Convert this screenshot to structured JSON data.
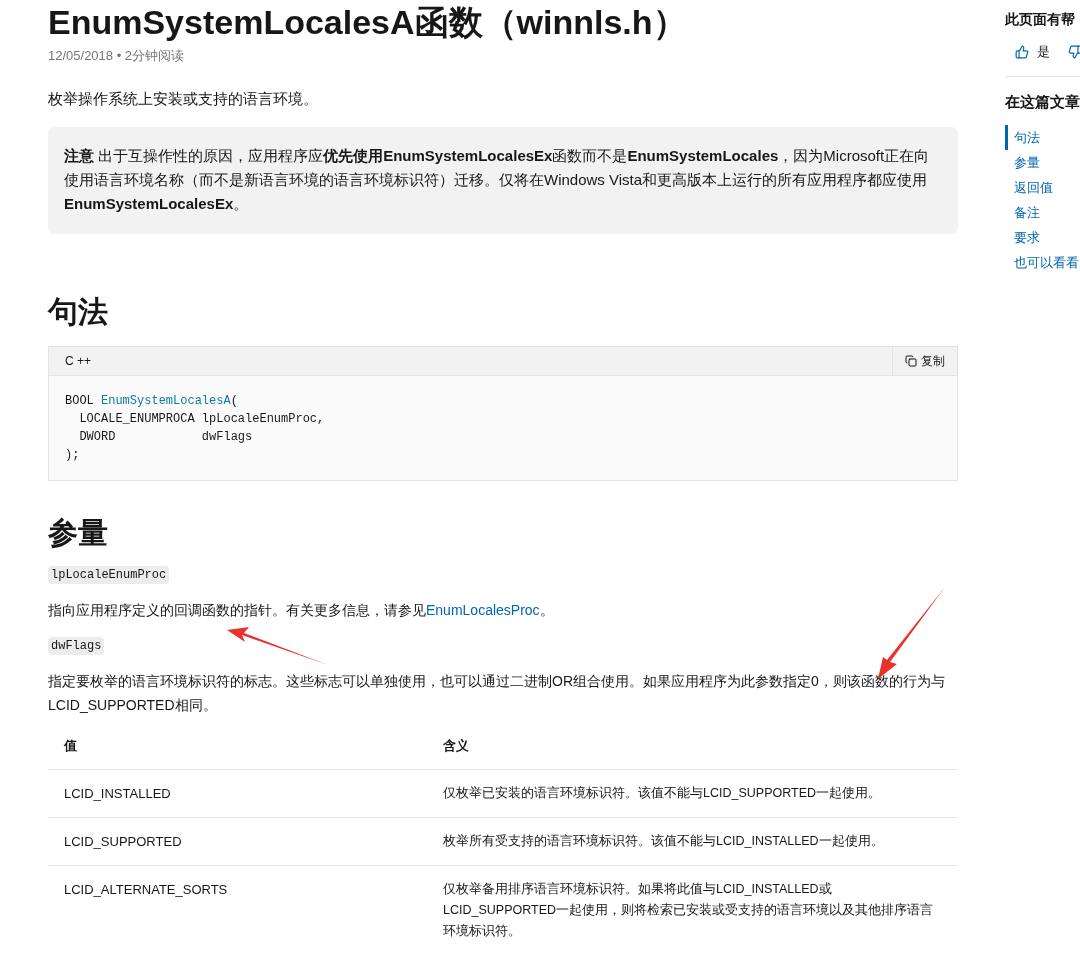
{
  "article": {
    "title": "EnumSystemLocalesA函数（winnls.h）",
    "meta": "12/05/2018 • 2分钟阅读",
    "summary": "枚举操作系统上安装或支持的语言环境。",
    "note": "**注意** 出于互操作性的原因，应用程序应**优先使用EnumSystemLocalesEx**函数而不是**EnumSystemLocales**，因为Microsoft正在向使用语言环境名称（而不是新语言环境的语言环境标识符）迁移。仅将在Windows Vista和更高版本上运行的所有应用程序都应使用**EnumSystemLocalesEx**。",
    "syntax_heading": "句法",
    "code": {
      "language": "C ++",
      "copy_label": "复制",
      "lines": [
        [
          {
            "kind": "plain",
            "text": "BOOL "
          },
          {
            "kind": "name",
            "text": "EnumSystemLocalesA"
          },
          {
            "kind": "plain",
            "text": "("
          }
        ],
        [
          {
            "kind": "plain",
            "text": "  LOCALE_ENUMPROCA lpLocaleEnumProc,"
          }
        ],
        [
          {
            "kind": "plain",
            "text": "  DWORD            dwFlags"
          }
        ],
        [
          {
            "kind": "plain",
            "text": ");"
          }
        ]
      ]
    },
    "params_heading": "参量",
    "params": [
      {
        "name": "lpLocaleEnumProc",
        "text_before": "指向应用程序定义的回调函数的指针。有关更多信息，请参见",
        "link": "EnumLocalesProc",
        "text_after": "。"
      },
      {
        "name": "dwFlags",
        "text_before": "指定要枚举的语言环境标识符的标志。这些标志可以单独使用，也可以通过二进制OR组合使用。如果应用程序为此参数指定0，则该函数的行为与LCID_SUPPORTED相同。"
      }
    ],
    "table": {
      "columns": [
        "值",
        "含义"
      ],
      "rows": [
        [
          "LCID_INSTALLED",
          "仅枚举已安装的语言环境标识符。该值不能与LCID_SUPPORTED一起使用。"
        ],
        [
          "LCID_SUPPORTED",
          "枚举所有受支持的语言环境标识符。该值不能与LCID_INSTALLED一起使用。"
        ],
        [
          "LCID_ALTERNATE_SORTS",
          "仅枚举备用排序语言环境标识符。如果将此值与LCID_INSTALLED或LCID_SUPPORTED一起使用，则将检索已安装或受支持的语言环境以及其他排序语言环境标识符。"
        ]
      ]
    }
  },
  "sidebar": {
    "feedback_title": "此页面有帮",
    "yes_label": "是",
    "toc_title": "在这篇文章",
    "toc": [
      {
        "label": "句法",
        "selected": true
      },
      {
        "label": "参量",
        "selected": false
      },
      {
        "label": "返回值",
        "selected": false
      },
      {
        "label": "备注",
        "selected": false
      },
      {
        "label": "要求",
        "selected": false
      },
      {
        "label": "也可以看看",
        "selected": false
      }
    ]
  }
}
